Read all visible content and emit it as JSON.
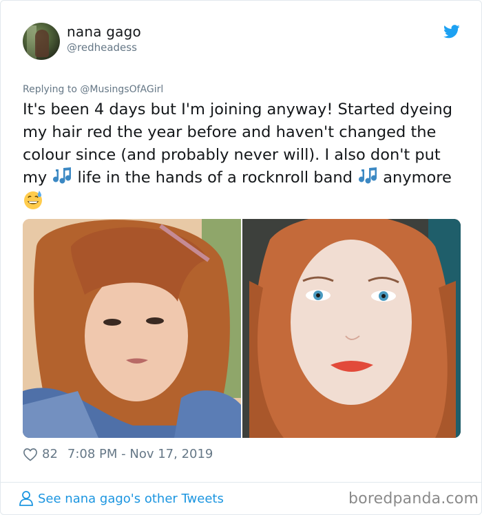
{
  "tweet": {
    "display_name": "nana gago",
    "handle": "@redheadess",
    "replying_prefix": "Replying to ",
    "replying_to": "@MusingsOfAGirl",
    "text_part1": "It's been 4 days but I'm joining anyway! Started dyeing my hair red the year before and haven't changed the colour since (and probably never will). I also don't put my ",
    "text_part2": " life in the hands of a rocknroll band ",
    "text_part3": " anymore ",
    "likes": "82",
    "timestamp": "7:08 PM - Nov 17, 2019",
    "emoji": [
      "musical-notes-icon",
      "musical-notes-icon",
      "grinning-sweat-emoji"
    ]
  },
  "footer": {
    "see_more": "See nana gago's other Tweets",
    "watermark": "boredpanda.com"
  },
  "colors": {
    "text": "#14171a",
    "muted": "#657786",
    "link": "#1b95e0",
    "twitter_blue": "#1da1f2",
    "border": "#e1e8ed"
  }
}
